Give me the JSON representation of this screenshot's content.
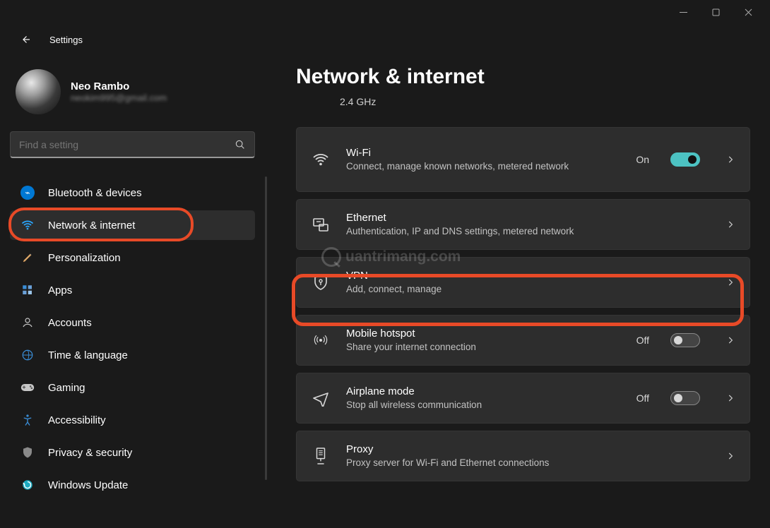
{
  "app_title": "Settings",
  "profile": {
    "name": "Neo Rambo",
    "email": "neokim995@gmail.com"
  },
  "search": {
    "placeholder": "Find a setting"
  },
  "nav": {
    "items": [
      {
        "label": "Bluetooth & devices"
      },
      {
        "label": "Network & internet"
      },
      {
        "label": "Personalization"
      },
      {
        "label": "Apps"
      },
      {
        "label": "Accounts"
      },
      {
        "label": "Time & language"
      },
      {
        "label": "Gaming"
      },
      {
        "label": "Accessibility"
      },
      {
        "label": "Privacy & security"
      },
      {
        "label": "Windows Update"
      }
    ]
  },
  "page": {
    "title": "Network & internet",
    "subline": "2.4 GHz"
  },
  "cards": {
    "wifi": {
      "title": "Wi-Fi",
      "desc": "Connect, manage known networks, metered network",
      "state": "On"
    },
    "ethernet": {
      "title": "Ethernet",
      "desc": "Authentication, IP and DNS settings, metered network"
    },
    "vpn": {
      "title": "VPN",
      "desc": "Add, connect, manage"
    },
    "hotspot": {
      "title": "Mobile hotspot",
      "desc": "Share your internet connection",
      "state": "Off"
    },
    "airplane": {
      "title": "Airplane mode",
      "desc": "Stop all wireless communication",
      "state": "Off"
    },
    "proxy": {
      "title": "Proxy",
      "desc": "Proxy server for Wi-Fi and Ethernet connections"
    }
  },
  "watermark": "uantrimang.com"
}
